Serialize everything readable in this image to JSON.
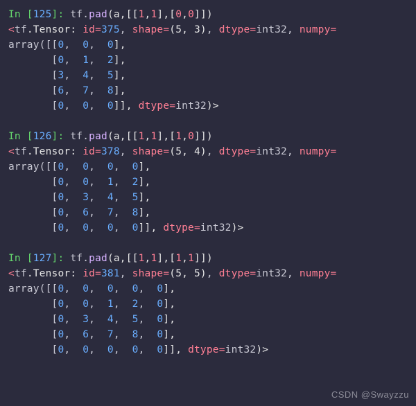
{
  "watermark": "CSDN @Swayzzu",
  "cells": [
    {
      "prompt_prefix": "In [",
      "prompt_num": "125",
      "prompt_suffix": "]: ",
      "call": {
        "obj": "tf",
        "method": "pad",
        "args": "(a,[[",
        "n1": "1",
        "n2": "1",
        "mid": "],[",
        "n3": "0",
        "n4": "0",
        "end": "]])"
      },
      "tensor": {
        "open": "<",
        "obj": "tf",
        "cls": ".Tensor: ",
        "kw_id": "id",
        "eq": "=",
        "id": "375",
        "kw_shape": "shape",
        "shape": "(5, 3)",
        "kw_dtype": "dtype",
        "dtype": "int32",
        "kw_numpy": "numpy",
        "eq2": "="
      },
      "array": {
        "head": "array([[",
        "rows": [
          [
            "0",
            "0",
            "0"
          ],
          [
            "0",
            "1",
            "2"
          ],
          [
            "3",
            "4",
            "5"
          ],
          [
            "6",
            "7",
            "8"
          ],
          [
            "0",
            "0",
            "0"
          ]
        ],
        "tail_dtype": "int32",
        "close": ")>"
      }
    },
    {
      "prompt_prefix": "In [",
      "prompt_num": "126",
      "prompt_suffix": "]: ",
      "call": {
        "obj": "tf",
        "method": "pad",
        "args": "(a,[[",
        "n1": "1",
        "n2": "1",
        "mid": "],[",
        "n3": "1",
        "n4": "0",
        "end": "]])"
      },
      "tensor": {
        "open": "<",
        "obj": "tf",
        "cls": ".Tensor: ",
        "kw_id": "id",
        "eq": "=",
        "id": "378",
        "kw_shape": "shape",
        "shape": "(5, 4)",
        "kw_dtype": "dtype",
        "dtype": "int32",
        "kw_numpy": "numpy",
        "eq2": "="
      },
      "array": {
        "head": "array([[",
        "rows": [
          [
            "0",
            "0",
            "0",
            "0"
          ],
          [
            "0",
            "0",
            "1",
            "2"
          ],
          [
            "0",
            "3",
            "4",
            "5"
          ],
          [
            "0",
            "6",
            "7",
            "8"
          ],
          [
            "0",
            "0",
            "0",
            "0"
          ]
        ],
        "tail_dtype": "int32",
        "close": ")>"
      }
    },
    {
      "prompt_prefix": "In [",
      "prompt_num": "127",
      "prompt_suffix": "]: ",
      "call": {
        "obj": "tf",
        "method": "pad",
        "args": "(a,[[",
        "n1": "1",
        "n2": "1",
        "mid": "],[",
        "n3": "1",
        "n4": "1",
        "end": "]])"
      },
      "tensor": {
        "open": "<",
        "obj": "tf",
        "cls": ".Tensor: ",
        "kw_id": "id",
        "eq": "=",
        "id": "381",
        "kw_shape": "shape",
        "shape": "(5, 5)",
        "kw_dtype": "dtype",
        "dtype": "int32",
        "kw_numpy": "numpy",
        "eq2": "="
      },
      "array": {
        "head": "array([[",
        "rows": [
          [
            "0",
            "0",
            "0",
            "0",
            "0"
          ],
          [
            "0",
            "0",
            "1",
            "2",
            "0"
          ],
          [
            "0",
            "3",
            "4",
            "5",
            "0"
          ],
          [
            "0",
            "6",
            "7",
            "8",
            "0"
          ],
          [
            "0",
            "0",
            "0",
            "0",
            "0"
          ]
        ],
        "tail_dtype": "int32",
        "close": ")>"
      }
    }
  ]
}
